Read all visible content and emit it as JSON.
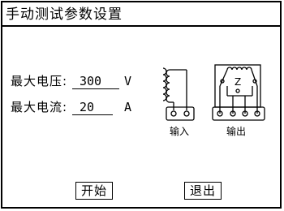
{
  "window": {
    "title": "手动测试参数设置"
  },
  "params": {
    "voltage": {
      "label": "最大电压:",
      "value": "300",
      "unit": "V"
    },
    "current": {
      "label": "最大电流:",
      "value": "20",
      "unit": "A"
    }
  },
  "diagram": {
    "input_label": "输入",
    "output_label": "输出",
    "load_label": "Z"
  },
  "buttons": {
    "start_label": "开始",
    "exit_label": "退出"
  }
}
